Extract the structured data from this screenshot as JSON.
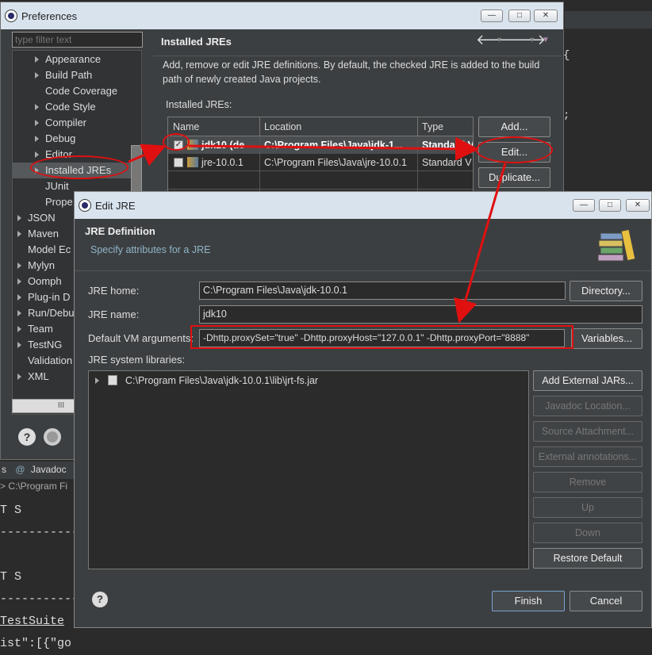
{
  "background_ide": {
    "tab_javadoc": "Javadoc",
    "tab_prefix": "s",
    "path_fragment": "> C:\\Program Fi",
    "console_lines": [
      "T S",
      "------------",
      "",
      "T S",
      "------------"
    ],
    "link_text": "TestSuite",
    "json_fragment": "ist\":[{\"go",
    "right_brace": "{",
    "right_semicolon": ";"
  },
  "preferences": {
    "title": "Preferences",
    "filter_placeholder": "type filter text",
    "tree": [
      {
        "label": "Appearance",
        "expand": true
      },
      {
        "label": "Build Path",
        "expand": true
      },
      {
        "label": "Code Coverage",
        "expand": false
      },
      {
        "label": "Code Style",
        "expand": true
      },
      {
        "label": "Compiler",
        "expand": true
      },
      {
        "label": "Debug",
        "expand": true
      },
      {
        "label": "Editor",
        "expand": true
      },
      {
        "label": "Installed JREs",
        "expand": true,
        "selected": true
      },
      {
        "label": "JUnit",
        "expand": false
      },
      {
        "label": "Prope",
        "expand": false
      }
    ],
    "tree_top": [
      {
        "label": "JSON",
        "expand": true
      },
      {
        "label": "Maven",
        "expand": true
      },
      {
        "label": "Model Ec",
        "expand": false
      },
      {
        "label": "Mylyn",
        "expand": true
      },
      {
        "label": "Oomph",
        "expand": true
      },
      {
        "label": "Plug-in D",
        "expand": true
      },
      {
        "label": "Run/Debu",
        "expand": true
      },
      {
        "label": "Team",
        "expand": true
      },
      {
        "label": "TestNG",
        "expand": true
      },
      {
        "label": "Validation",
        "expand": false
      },
      {
        "label": "XML",
        "expand": true
      }
    ],
    "page_title": "Installed JREs",
    "description": "Add, remove or edit JRE definitions. By default, the checked JRE is added to the build path of newly created Java projects.",
    "jres_label": "Installed JREs:",
    "columns": [
      "Name",
      "Location",
      "Type"
    ],
    "rows": [
      {
        "name": "jdk10 (de",
        "location": "C:\\Program Files\\Java\\jdk-1...",
        "type": "Standard V",
        "checked": true
      },
      {
        "name": "jre-10.0.1",
        "location": "C:\\Program Files\\Java\\jre-10.0.1",
        "type": "Standard V",
        "checked": false
      }
    ],
    "btn_add": "Add...",
    "btn_edit": "Edit...",
    "btn_duplicate": "Duplicate...",
    "hscroll": "III"
  },
  "edit_jre": {
    "title": "Edit JRE",
    "heading": "JRE Definition",
    "subheading": "Specify attributes for a JRE",
    "jre_home_label": "JRE home:",
    "jre_home_value": "C:\\Program Files\\Java\\jdk-10.0.1",
    "btn_directory": "Directory...",
    "jre_name_label": "JRE name:",
    "jre_name_value": "jdk10",
    "vm_args_label": "Default VM arguments:",
    "vm_args_value": "-Dhttp.proxySet=\"true\" -Dhttp.proxyHost=\"127.0.0.1\" -Dhttp.proxyPort=\"8888\"",
    "btn_variables": "Variables...",
    "syslib_label": "JRE system libraries:",
    "syslib_item": "C:\\Program Files\\Java\\jdk-10.0.1\\lib\\jrt-fs.jar",
    "side_buttons": [
      {
        "label": "Add External JARs...",
        "enabled": true
      },
      {
        "label": "Javadoc Location...",
        "enabled": false
      },
      {
        "label": "Source Attachment...",
        "enabled": false
      },
      {
        "label": "External annotations...",
        "enabled": false
      },
      {
        "label": "Remove",
        "enabled": false
      },
      {
        "label": "Up",
        "enabled": false
      },
      {
        "label": "Down",
        "enabled": false
      },
      {
        "label": "Restore Default",
        "enabled": true
      }
    ],
    "btn_finish": "Finish",
    "btn_cancel": "Cancel"
  },
  "colors": {
    "annotation": "#e01010",
    "dialog_bg": "#3c3f41",
    "titlebar": "#d9e3ee"
  }
}
